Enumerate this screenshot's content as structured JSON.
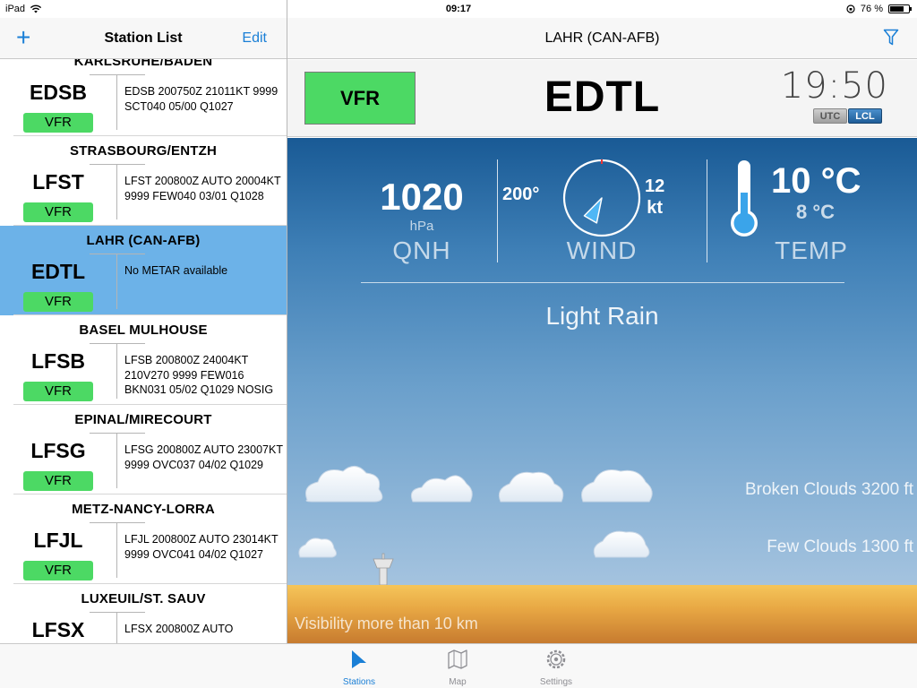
{
  "status_bar": {
    "device": "iPad",
    "time": "09:17",
    "battery": "76 %",
    "battery_level": 0.76
  },
  "left_nav": {
    "title": "Station List",
    "add_label": "+",
    "edit_label": "Edit"
  },
  "stations": [
    {
      "name": "KARLSRUHE/BADEN",
      "icao": "EDSB",
      "category": "VFR",
      "metar": "EDSB 200750Z 21011KT 9999 SCT040 05/00 Q1027"
    },
    {
      "name": "STRASBOURG/ENTZH",
      "icao": "LFST",
      "category": "VFR",
      "metar": "LFST 200800Z AUTO 20004KT 9999 FEW040 03/01 Q1028"
    },
    {
      "name": "LAHR (CAN-AFB)",
      "icao": "EDTL",
      "category": "VFR",
      "metar": "No METAR available"
    },
    {
      "name": "BASEL MULHOUSE",
      "icao": "LFSB",
      "category": "VFR",
      "metar": "LFSB 200800Z 24004KT 210V270 9999 FEW016 BKN031 05/02 Q1029 NOSIG"
    },
    {
      "name": "EPINAL/MIRECOURT",
      "icao": "LFSG",
      "category": "VFR",
      "metar": "LFSG 200800Z AUTO 23007KT 9999 OVC037 04/02 Q1029"
    },
    {
      "name": "METZ-NANCY-LORRA",
      "icao": "LFJL",
      "category": "VFR",
      "metar": "LFJL 200800Z AUTO 23014KT 9999 OVC041 04/02 Q1027"
    },
    {
      "name": "LUXEUIL/ST. SAUV",
      "icao": "LFSX",
      "category": "",
      "metar": "LFSX 200800Z AUTO"
    }
  ],
  "detail": {
    "title": "LAHR (CAN-AFB)",
    "category": "VFR",
    "icao": "EDTL",
    "clock": "19:50",
    "tz_utc": "UTC",
    "tz_lcl": "LCL",
    "qnh": "1020",
    "qnh_unit": "hPa",
    "qnh_label": "QNH",
    "wind_dir": "200°",
    "wind_dir_deg": 200,
    "wind_speed": "12",
    "wind_unit": "kt",
    "wind_label": "WIND",
    "temp": "10 °C",
    "dewpoint": "8 °C",
    "temp_label": "TEMP",
    "condition": "Light Rain",
    "cloud_layer_1": "Broken Clouds 3200 ft",
    "cloud_layer_2": "Few Clouds 1300 ft",
    "visibility": "Visibility more than 10 km"
  },
  "tabs": [
    {
      "label": "Stations",
      "icon": "stations-icon",
      "active": true
    },
    {
      "label": "Map",
      "icon": "map-icon",
      "active": false
    },
    {
      "label": "Settings",
      "icon": "settings-icon",
      "active": false
    }
  ],
  "colors": {
    "accent": "#1a7fd6",
    "vfr_green": "#4cd964",
    "selected_row": "#6cb2e8"
  }
}
